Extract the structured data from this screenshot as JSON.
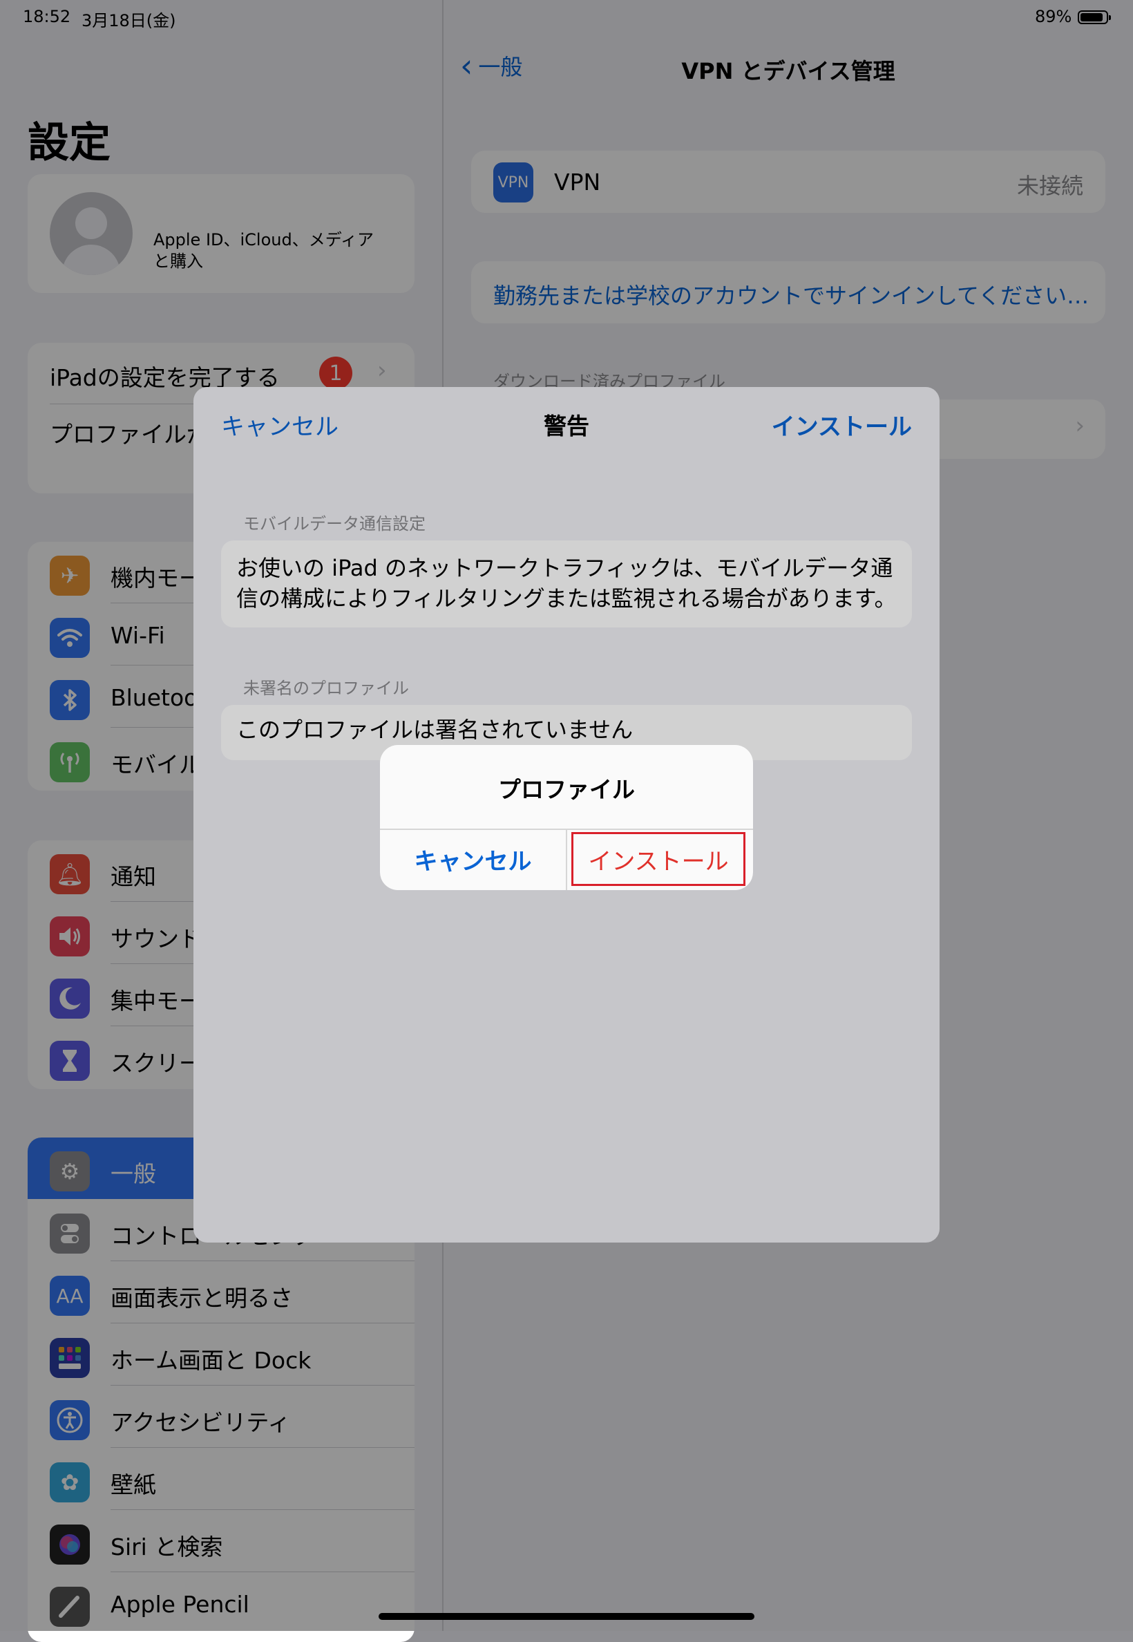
{
  "status_bar": {
    "time": "18:52",
    "date": "3月18日(金)",
    "battery_percent": "89%",
    "battery_level": 0.89
  },
  "sidebar": {
    "title": "設定",
    "account_text": "Apple ID、iCloud、メディアと購入",
    "setup_group": [
      {
        "label": "iPadの設定を完了する",
        "badge": "1"
      },
      {
        "label": "プロファイルがダウンロード済み"
      }
    ],
    "connectivity_group": [
      {
        "label": "機内モード",
        "icon": "airplane-icon",
        "color": "#f09a37"
      },
      {
        "label": "Wi-Fi",
        "icon": "wifi-icon",
        "color": "#3478f6"
      },
      {
        "label": "Bluetooth",
        "icon": "bluetooth-icon",
        "color": "#3478f6"
      },
      {
        "label": "モバイルデータ通信",
        "icon": "antenna-icon",
        "color": "#65c466"
      }
    ],
    "notifications_group": [
      {
        "label": "通知",
        "icon": "bell-icon",
        "color": "#eb4e3d"
      },
      {
        "label": "サウンド",
        "icon": "speaker-icon",
        "color": "#eb445a"
      },
      {
        "label": "集中モード",
        "icon": "moon-icon",
        "color": "#5e5ce6"
      },
      {
        "label": "スクリーンタイム",
        "icon": "hourglass-icon",
        "color": "#5e5ce6"
      }
    ],
    "general_group": [
      {
        "label": "一般",
        "icon": "gear-icon",
        "color": "#8e8e93",
        "selected": true
      },
      {
        "label": "コントロールセンター",
        "icon": "toggles-icon",
        "color": "#8e8e93"
      },
      {
        "label": "画面表示と明るさ",
        "icon": "text-size-icon",
        "color": "#3478f6"
      },
      {
        "label": "ホーム画面と Dock",
        "icon": "home-grid-icon",
        "color": "#2c3fa6"
      },
      {
        "label": "アクセシビリティ",
        "icon": "accessibility-icon",
        "color": "#3478f6"
      },
      {
        "label": "壁紙",
        "icon": "flower-icon",
        "color": "#35aadc"
      },
      {
        "label": "Siri と検索",
        "icon": "siri-icon",
        "color": "#222222"
      },
      {
        "label": "Apple Pencil",
        "icon": "pencil-icon",
        "color": "#555555"
      }
    ]
  },
  "detail": {
    "back_label": "一般",
    "title": "VPN とデバイス管理",
    "vpn_icon_text": "VPN",
    "vpn_label": "VPN",
    "vpn_status": "未接続",
    "signin_link": "勤務先または学校のアカウントでサインインしてください…",
    "downloaded_header": "ダウンロード済みプロファイル"
  },
  "sheet": {
    "cancel_label": "キャンセル",
    "title": "警告",
    "install_label": "インストール",
    "mobile_header": "モバイルデータ通信設定",
    "mobile_text_line1": "お使いの iPad のネットワークトラフィックは、モバイルデータ通",
    "mobile_text_line2": "信の構成によりフィルタリングまたは監視される場合があります。",
    "unsigned_header": "未署名のプロファイル",
    "unsigned_text": "このプロファイルは署名されていません"
  },
  "alert": {
    "title": "プロファイル",
    "cancel_label": "キャンセル",
    "install_label": "インストール",
    "highlight_color": "#d9202a"
  }
}
